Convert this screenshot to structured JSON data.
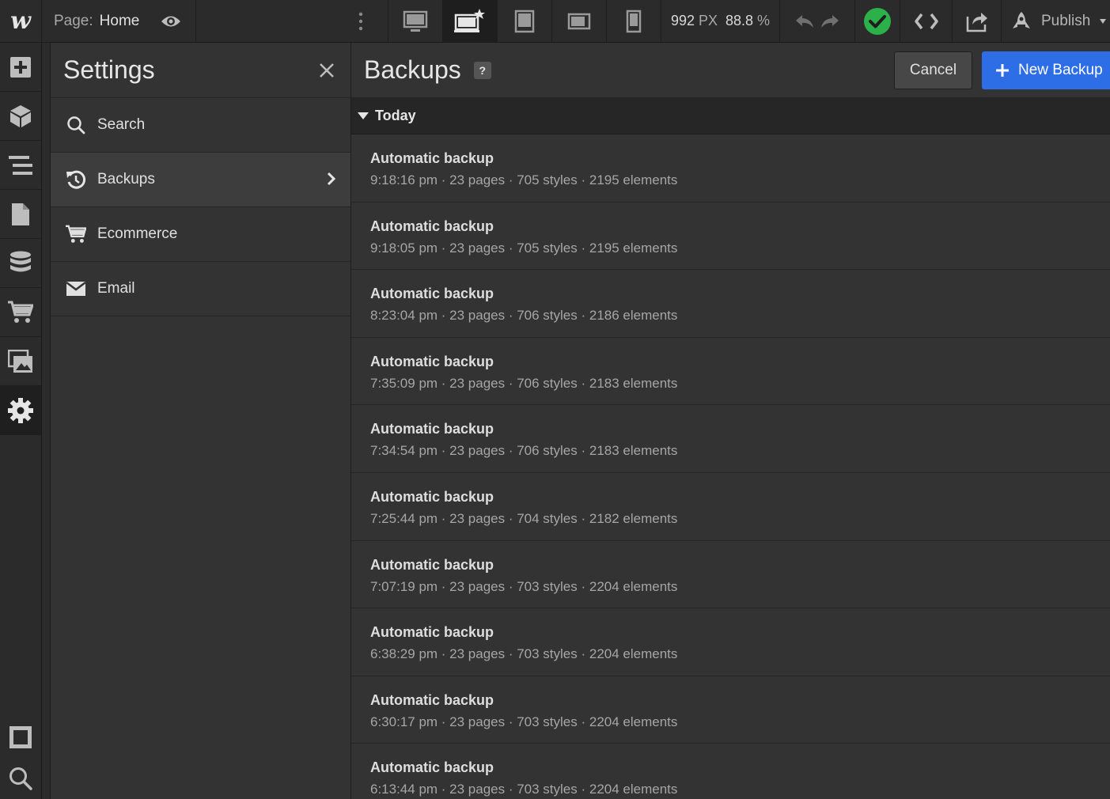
{
  "topbar": {
    "logo": "w",
    "page_key": "Page:",
    "page_value": "Home",
    "width_value": "992",
    "width_unit": "PX",
    "zoom_value": "88.8",
    "zoom_unit": "%",
    "publish_label": "Publish",
    "check_color": "#2bb04a"
  },
  "settings": {
    "title": "Settings",
    "items": [
      {
        "label": "Search",
        "icon": "search-icon"
      },
      {
        "label": "Backups",
        "icon": "backup-history-icon"
      },
      {
        "label": "Ecommerce",
        "icon": "cart-icon"
      },
      {
        "label": "Email",
        "icon": "envelope-icon"
      }
    ]
  },
  "backups": {
    "title": "Backups",
    "help": "?",
    "cancel_label": "Cancel",
    "new_label": "New Backup",
    "accent": "#2d6ee6",
    "group_label": "Today",
    "rows": [
      {
        "title": "Automatic backup",
        "meta": "9:18:16 pm · 23 pages · 705 styles · 2195 elements"
      },
      {
        "title": "Automatic backup",
        "meta": "9:18:05 pm · 23 pages · 705 styles · 2195 elements"
      },
      {
        "title": "Automatic backup",
        "meta": "8:23:04 pm · 23 pages · 706 styles · 2186 elements"
      },
      {
        "title": "Automatic backup",
        "meta": "7:35:09 pm · 23 pages · 706 styles · 2183 elements"
      },
      {
        "title": "Automatic backup",
        "meta": "7:34:54 pm · 23 pages · 706 styles · 2183 elements"
      },
      {
        "title": "Automatic backup",
        "meta": "7:25:44 pm · 23 pages · 704 styles · 2182 elements"
      },
      {
        "title": "Automatic backup",
        "meta": "7:07:19 pm · 23 pages · 703 styles · 2204 elements"
      },
      {
        "title": "Automatic backup",
        "meta": "6:38:29 pm · 23 pages · 703 styles · 2204 elements"
      },
      {
        "title": "Automatic backup",
        "meta": "6:30:17 pm · 23 pages · 703 styles · 2204 elements"
      },
      {
        "title": "Automatic backup",
        "meta": "6:13:44 pm · 23 pages · 703 styles · 2204 elements"
      }
    ]
  }
}
